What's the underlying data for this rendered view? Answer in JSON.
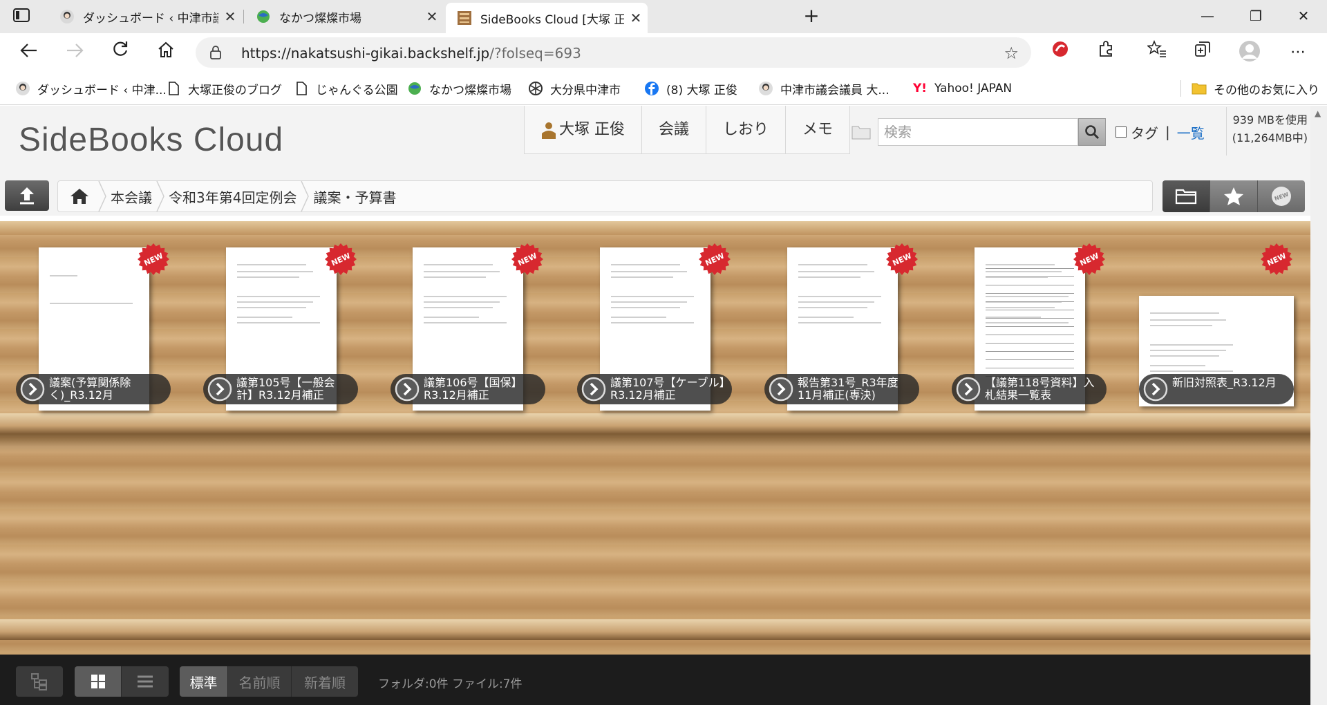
{
  "browser": {
    "tabs": [
      {
        "title": "ダッシュボード ‹ 中津市議会議員 大",
        "active": false
      },
      {
        "title": "なかつ燦燦市場",
        "active": false
      },
      {
        "title": "SideBooks Cloud [大塚 正俊] 議案",
        "active": true
      }
    ],
    "url_host": "https://nakatsushi-gikai.backshelf.jp",
    "url_path": "/?folseq=693",
    "bookmarks": [
      {
        "label": "ダッシュボード ‹ 中津...",
        "icon": "avatar-icon"
      },
      {
        "label": "大塚正俊のブログ",
        "icon": "page-icon"
      },
      {
        "label": "じゃんぐる公園",
        "icon": "page-icon"
      },
      {
        "label": "なかつ燦燦市場",
        "icon": "globe-icon"
      },
      {
        "label": "大分県中津市",
        "icon": "emblem-icon"
      },
      {
        "label": "(8) 大塚 正俊",
        "icon": "facebook-icon"
      },
      {
        "label": "中津市議会議員 大...",
        "icon": "avatar-icon"
      },
      {
        "label": "Yahoo! JAPAN",
        "icon": "yahoo-icon"
      }
    ],
    "other_bookmarks": "その他のお気に入り"
  },
  "site": {
    "logo": "SideBooks Cloud",
    "menu": {
      "user": "大塚 正俊",
      "meeting": "会議",
      "bookmark": "しおり",
      "memo": "メモ"
    },
    "search": {
      "placeholder": "検索"
    },
    "tag_label": "タグ",
    "tag_sep": "|",
    "list_link": "一覧",
    "usage_line1": "939 MBを使用",
    "usage_line2": "(11,264MB中)"
  },
  "breadcrumb": [
    "本会議",
    "令和3年第4回定例会",
    "議案・予算書"
  ],
  "books": [
    {
      "title": "議案(予算関係除く)_R3.12月",
      "new": true
    },
    {
      "title": "議第105号【一般会計】R3.12月補正",
      "new": true
    },
    {
      "title": "議第106号【国保】R3.12月補正",
      "new": true
    },
    {
      "title": "議第107号【ケーブル】R3.12月補正",
      "new": true
    },
    {
      "title": "報告第31号_R3年度11月補正(専決)",
      "new": true
    },
    {
      "title": "【議第118号資料】入札結果一覧表",
      "new": true
    },
    {
      "title": "新旧対照表_R3.12月",
      "new": true
    }
  ],
  "bottom": {
    "sort_standard": "標準",
    "sort_name": "名前順",
    "sort_new": "新着順",
    "counts": "フォルダ:0件 ファイル:7件"
  },
  "colors": {
    "accent_link": "#1a6ec6",
    "new_badge": "#d7282f"
  }
}
